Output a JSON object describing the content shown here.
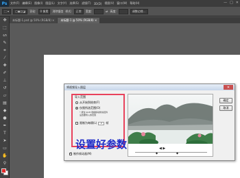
{
  "app": {
    "logo": "Ps"
  },
  "menubar": {
    "items": [
      "文件(F)",
      "编辑(E)",
      "图像(I)",
      "图层(L)",
      "文字(Y)",
      "选择(S)",
      "滤镜(T)",
      "3D(D)",
      "视图(V)",
      "窗口(W)",
      "帮助(H)"
    ]
  },
  "window_controls": [
    "—",
    "□",
    "✕"
  ],
  "options_bar": {
    "feather_label": "羽化:",
    "feather_value": "0 像素",
    "antialias_label": "消除锯齿",
    "style_label": "样式:",
    "style_value": "正常",
    "width_label": "宽度:",
    "height_label": "高度:",
    "refine_edge": "调整边缘..."
  },
  "tabs": [
    {
      "label": "未标题-1.psd @ 50% (RGB/8) ×",
      "active": false
    },
    {
      "label": "未标题-1 @ 50% (RGB/8) ×",
      "active": true
    }
  ],
  "dialog": {
    "title": "将视频导入图层",
    "close_label": "✕",
    "section_title": "导入范围",
    "option_all": "从开始到结束(F)",
    "option_range": "仅限所选范围(O)",
    "hint_line1": "* 按住 Shift 键拖移动修剪控件",
    "hint_line2": "设置要导入的范围",
    "limit_label": "限制为每隔(L)",
    "limit_value": "2",
    "limit_unit": "帧",
    "make_anim_label": "制作帧动画(M)",
    "ok_label": "确定",
    "cancel_label": "取消"
  },
  "caption": "设置好参数",
  "colors": {
    "highlight_box": "#e8415b",
    "caption": "#1e2cc8",
    "ps_blue": "#31a8ff"
  },
  "icons": [
    "move-icon",
    "marquee-icon",
    "lasso-icon",
    "quick-select-icon",
    "crop-icon",
    "eyedropper-icon",
    "healing-icon",
    "brush-icon",
    "stamp-icon",
    "history-brush-icon",
    "eraser-icon",
    "gradient-icon",
    "blur-icon",
    "dodge-icon",
    "pen-icon",
    "type-icon",
    "path-select-icon",
    "shape-icon",
    "hand-icon",
    "zoom-icon"
  ]
}
